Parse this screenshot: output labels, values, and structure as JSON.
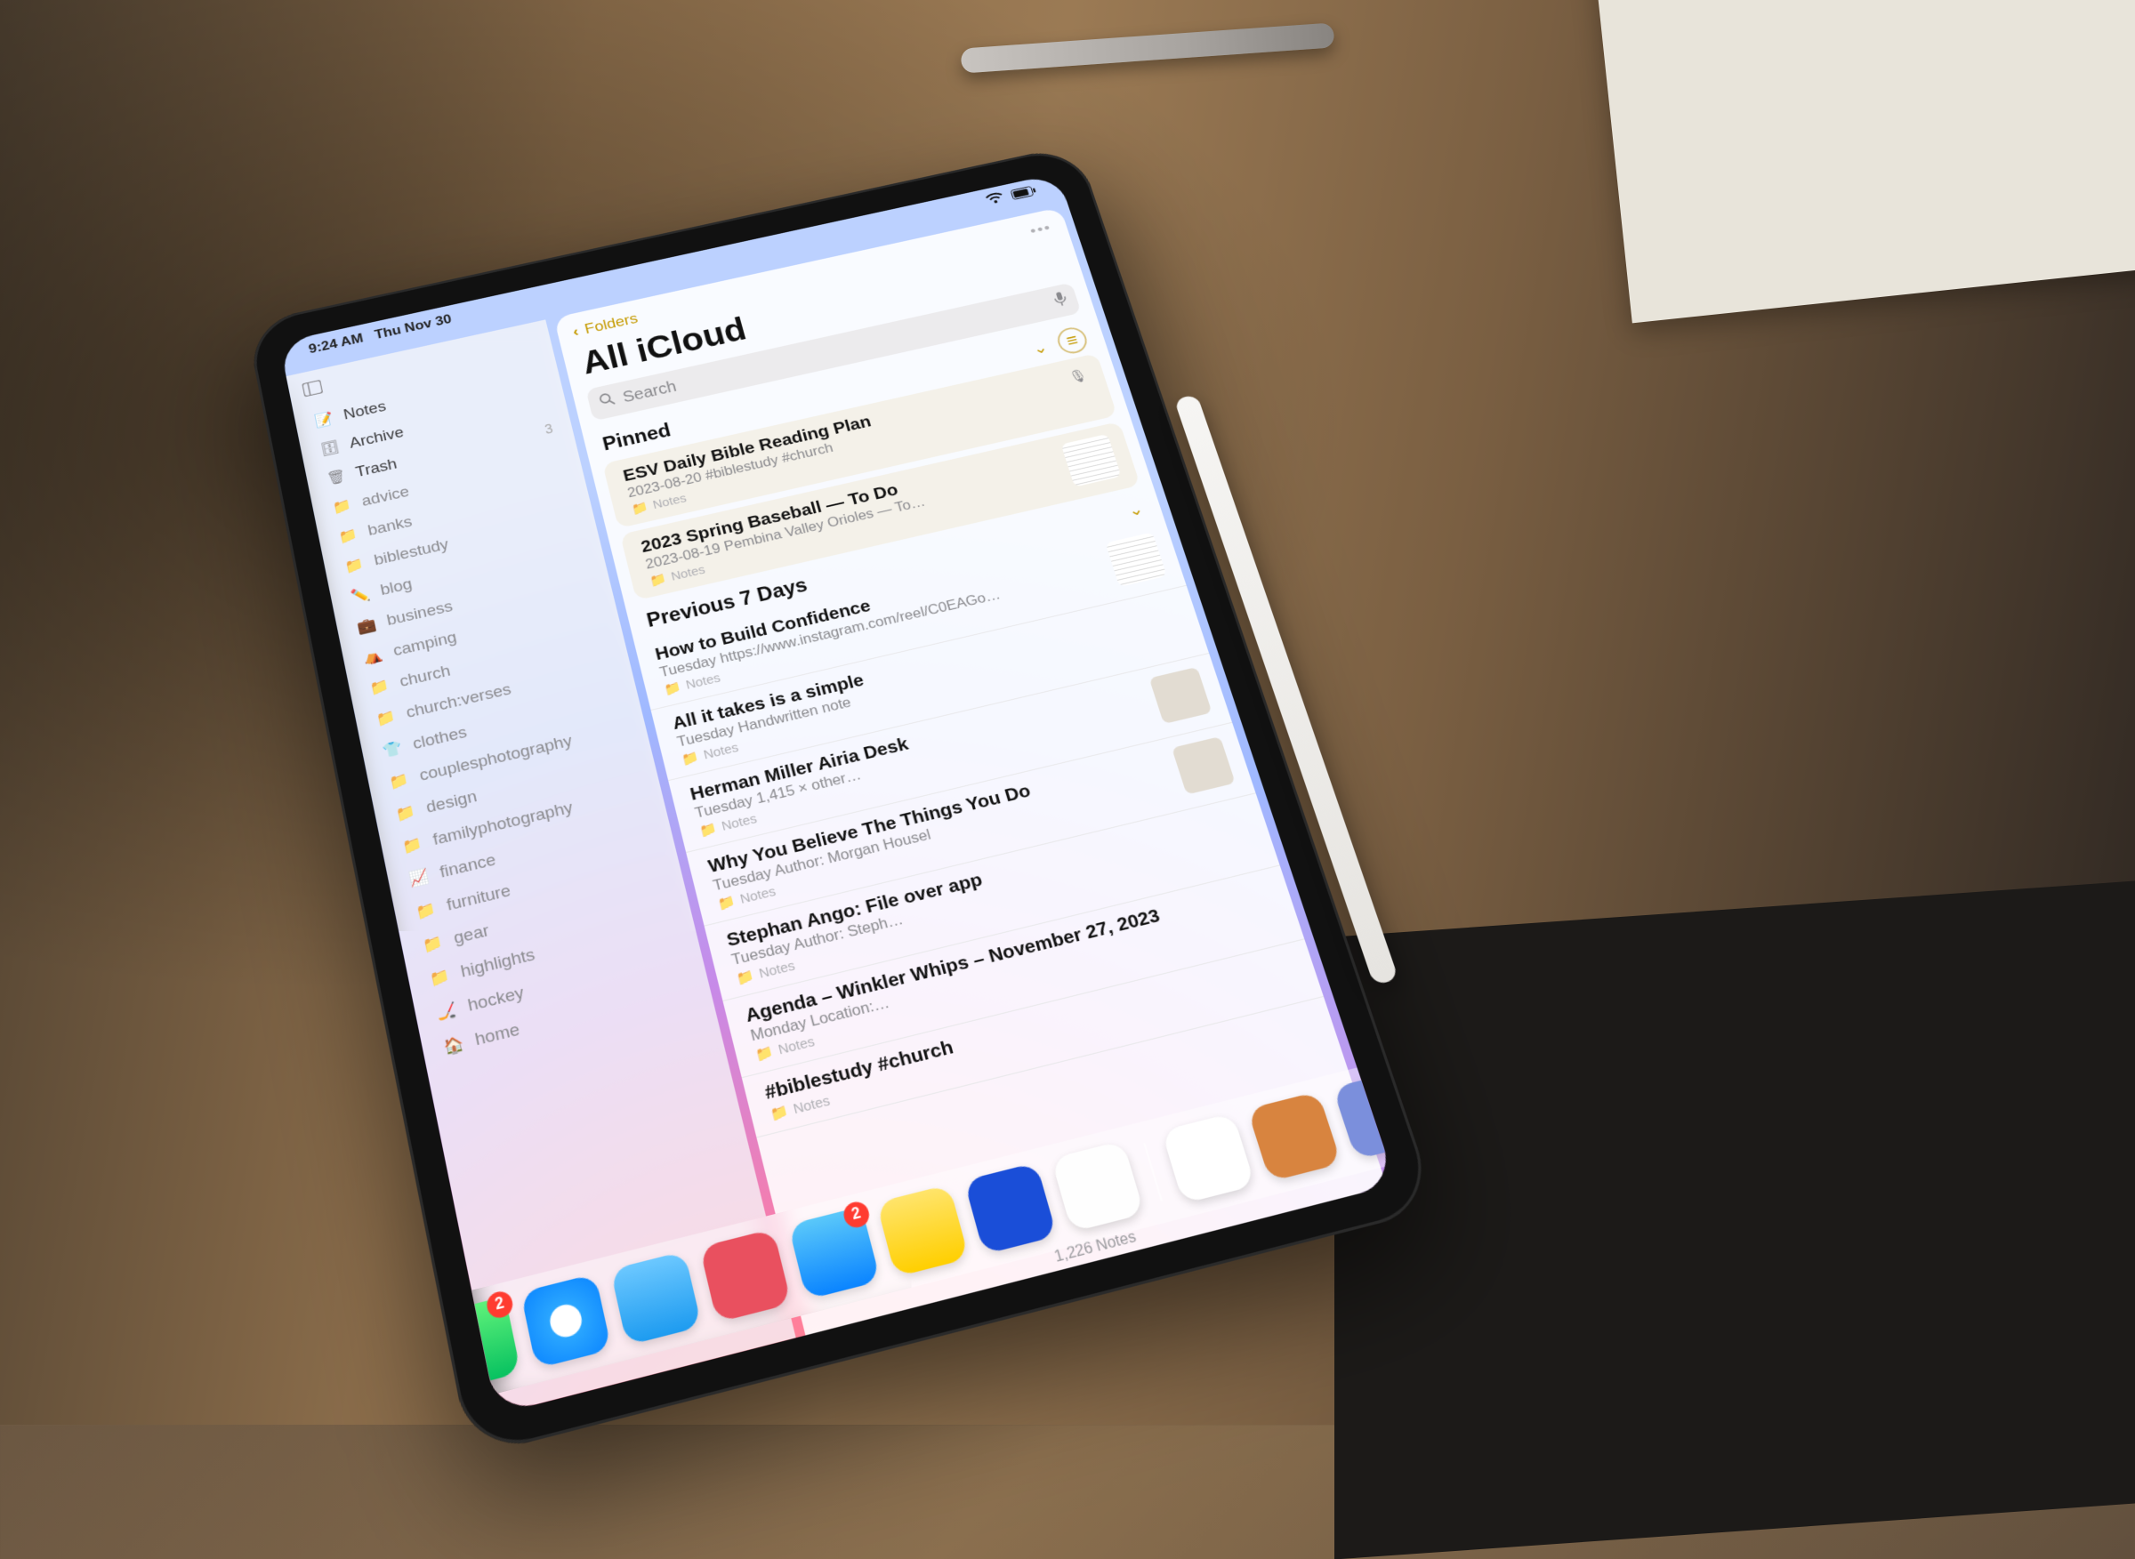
{
  "statusbar": {
    "time": "9:24 AM",
    "date": "Thu Nov 30"
  },
  "sidebar": {
    "items": [
      {
        "icon": "note-icon",
        "label": "Notes"
      },
      {
        "icon": "archive-icon",
        "label": "Archive"
      },
      {
        "icon": "trash-icon",
        "label": "Trash",
        "count": "3"
      },
      {
        "icon": "folder-icon",
        "label": "advice"
      },
      {
        "icon": "folder-icon",
        "label": "banks"
      },
      {
        "icon": "folder-icon",
        "label": "biblestudy"
      },
      {
        "icon": "pencil-icon",
        "label": "blog"
      },
      {
        "icon": "briefcase-icon",
        "label": "business"
      },
      {
        "icon": "tent-icon",
        "label": "camping"
      },
      {
        "icon": "folder-icon",
        "label": "church"
      },
      {
        "icon": "folder-icon",
        "label": "church:verses"
      },
      {
        "icon": "shirt-icon",
        "label": "clothes"
      },
      {
        "icon": "folder-icon",
        "label": "couplesphotography"
      },
      {
        "icon": "folder-icon",
        "label": "design"
      },
      {
        "icon": "folder-icon",
        "label": "familyphotography"
      },
      {
        "icon": "chart-icon",
        "label": "finance"
      },
      {
        "icon": "folder-icon",
        "label": "furniture"
      },
      {
        "icon": "folder-icon",
        "label": "gear"
      },
      {
        "icon": "folder-icon",
        "label": "highlights"
      },
      {
        "icon": "puck-icon",
        "label": "hockey"
      },
      {
        "icon": "home-icon",
        "label": "home"
      }
    ]
  },
  "notesPanel": {
    "back_label": "Folders",
    "title": "All iCloud",
    "search_placeholder": "Search",
    "sections": {
      "pinned_label": "Pinned",
      "recent_label": "Previous 7 Days"
    },
    "pinned": [
      {
        "title": "ESV Daily Bible Reading Plan",
        "sub": "2023-08-20  #biblestudy #church",
        "folder": "Notes",
        "thumb": "mic"
      },
      {
        "title": "2023 Spring Baseball — To Do",
        "sub": "2023-08-19  Pembina Valley Orioles — To…",
        "folder": "Notes",
        "thumb": "lines"
      }
    ],
    "recent": [
      {
        "title": "How to Build Confidence",
        "sub": "Tuesday  https://www.instagram.com/reel/C0EAGo…",
        "folder": "Notes",
        "thumb": "lines"
      },
      {
        "title": "All it takes is a simple",
        "sub": "Tuesday  Handwritten note",
        "folder": "Notes"
      },
      {
        "title": "Herman Miller Airia Desk",
        "sub": "Tuesday  1,415 × other…",
        "folder": "Notes",
        "thumb": "photo"
      },
      {
        "title": "Why You Believe The Things You Do",
        "sub": "Tuesday  Author: Morgan Housel",
        "folder": "Notes",
        "thumb": "photo"
      },
      {
        "title": "Stephan Ango: File over app",
        "sub": "Tuesday  Author: Steph…",
        "folder": "Notes"
      },
      {
        "title": "Agenda – Winkler Whips – November 27, 2023",
        "sub": "Monday  Location:…",
        "folder": "Notes"
      },
      {
        "title": "#biblestudy #church",
        "sub": "",
        "folder": "Notes"
      }
    ],
    "footer": "1,226 Notes"
  },
  "dock": {
    "apps": [
      {
        "name": "messages",
        "cls": "green",
        "badge": "2"
      },
      {
        "name": "safari",
        "cls": "safari"
      },
      {
        "name": "mail",
        "cls": "mail"
      },
      {
        "name": "drafts",
        "cls": "drafts"
      },
      {
        "name": "telegram",
        "cls": "plane",
        "badge": "2"
      },
      {
        "name": "things",
        "cls": "yellow"
      },
      {
        "name": "1password",
        "cls": "onepass"
      },
      {
        "name": "files",
        "cls": "files"
      },
      {
        "name": "craft",
        "cls": "craft"
      },
      {
        "name": "app-misc-a",
        "cls": "misc1"
      },
      {
        "name": "app-misc-b",
        "cls": "misc2"
      }
    ],
    "separator_after": 8
  }
}
